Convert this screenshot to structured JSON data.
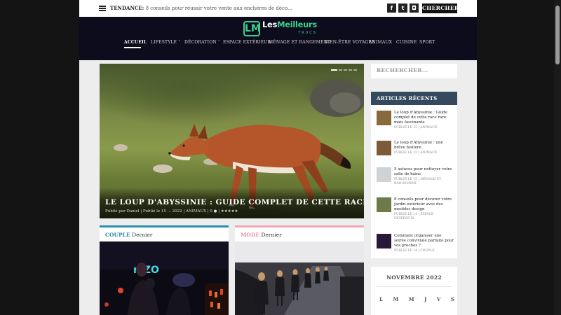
{
  "topbar": {
    "trend_label": "TENDANCE",
    "trend_text": "8 conseils pour réussir votre vente aux enchères de déco...",
    "social": [
      {
        "icon": "facebook-icon",
        "glyph": "f"
      },
      {
        "icon": "twitter-icon",
        "glyph": "t"
      },
      {
        "icon": "instagram-icon",
        "glyph": "◘"
      }
    ],
    "search_label": "CHERCHER"
  },
  "header": {
    "logo_mark": "LM",
    "logo_text_prefix": "Les",
    "logo_text_main": "Meilleurs",
    "logo_sub": "TRUCS",
    "nav": [
      {
        "label": "ACCUEIL",
        "active": true
      },
      {
        "label": "LIFESTYLE ˅",
        "active": false
      },
      {
        "label": "DÉCORATION ˅",
        "active": false
      },
      {
        "label": "ESPACE EXTÉRIEUR",
        "active": false
      },
      {
        "label": "MÉNAGE ET RANGEMENT",
        "active": false
      },
      {
        "label": "BIEN-ÊTRE VOYAGES",
        "active": false
      },
      {
        "label": "ANIMAUX",
        "active": false
      },
      {
        "label": "CUISINE",
        "active": false
      },
      {
        "label": "SPORT",
        "active": false
      }
    ]
  },
  "hero": {
    "title": "LE LOUP D'ABYSSINIE : GUIDE COMPLET DE CETTE RACE RARE MAIS FASCINANTE",
    "meta": "Publié par Daniel | Publié le 15 ... 2022 | ANIMAUX | 0 ● | ★★★★★"
  },
  "cards": [
    {
      "category": "COUPLE",
      "label": "Dernier",
      "accent": "#2a8ea8"
    },
    {
      "category": "MODE",
      "label": "Dernier",
      "accent": "#f4a6b4"
    }
  ],
  "sidebar": {
    "search_placeholder": "RECHERCHER...",
    "recent_title": "ARTICLES RÉCENTS",
    "recent": [
      {
        "title": "Le loup d'Abyssinie : Guide complet de cette race rare mais fascinante",
        "meta": "PUBLIÉ LE 15 | ANIMAUX"
      },
      {
        "title": "Le loup d'Abyssinie : une brève histoire",
        "meta": "PUBLIÉ LE 15 | ANIMAUX"
      },
      {
        "title": "5 astuces pour nettoyer votre salle de bains",
        "meta": "PUBLIÉ LE 15 | MÉNAGE ET RANGEMENT"
      },
      {
        "title": "8 conseils pour décorer votre jardin extérieur avec des meubles design",
        "meta": "PUBLIÉ LE 14 | ESPACE EXTÉRIEUR"
      },
      {
        "title": "Comment organiser une soirée conviviale parfaite pour vos proches ?",
        "meta": "PUBLIÉ LE 14 | COUPLE"
      }
    ],
    "calendar_title": "NOVEMBRE 2022",
    "calendar_days": [
      "L",
      "M",
      "M",
      "J",
      "V",
      "S"
    ]
  },
  "colors": {
    "header_bg": "#0d0c1d",
    "brand_green": "#3ecf8e",
    "sidebar_head": "#34495e"
  }
}
